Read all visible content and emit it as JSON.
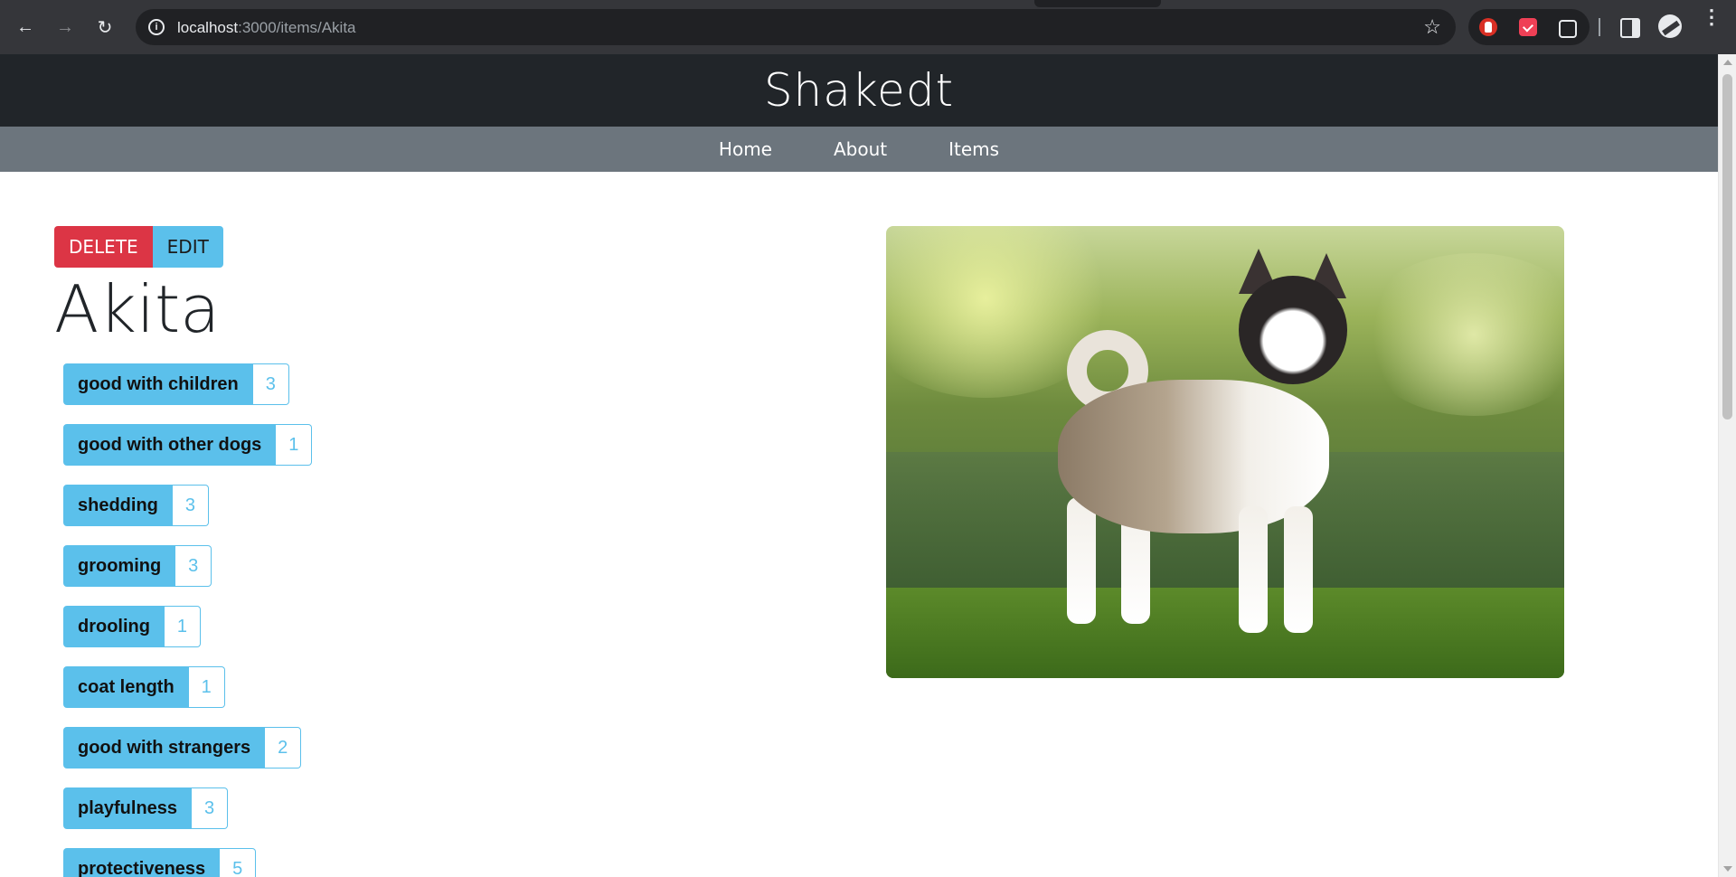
{
  "browser": {
    "url_host": "localhost",
    "url_rest": ":3000/items/Akita"
  },
  "site": {
    "title": "Shakedt",
    "nav": [
      "Home",
      "About",
      "Items"
    ]
  },
  "item": {
    "name": "Akita",
    "actions": {
      "delete_label": "DELETE",
      "edit_label": "EDIT"
    },
    "traits": [
      {
        "label": "good with children",
        "score": "3"
      },
      {
        "label": "good with other dogs",
        "score": "1"
      },
      {
        "label": "shedding",
        "score": "3"
      },
      {
        "label": "grooming",
        "score": "3"
      },
      {
        "label": "drooling",
        "score": "1"
      },
      {
        "label": "coat length",
        "score": "1"
      },
      {
        "label": "good with strangers",
        "score": "2"
      },
      {
        "label": "playfulness",
        "score": "3"
      },
      {
        "label": "protectiveness",
        "score": "5"
      }
    ]
  },
  "colors": {
    "header_bg": "#212529",
    "nav_bg": "#6c757d",
    "delete": "#dc3545",
    "edit": "#5bc0eb",
    "trait_badge": "#5bc0eb"
  }
}
